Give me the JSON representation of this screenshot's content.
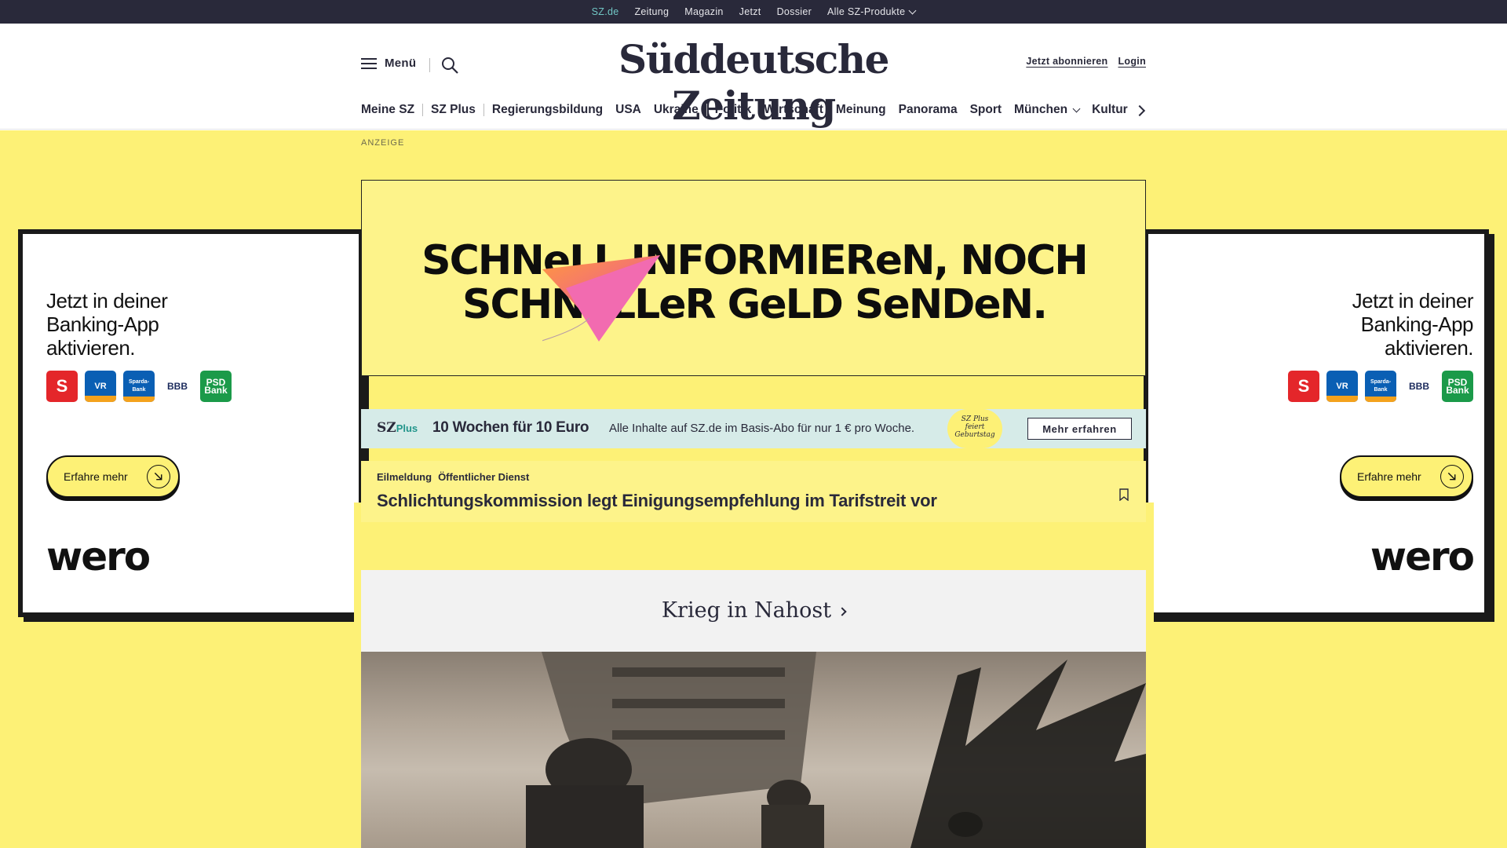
{
  "topbar": {
    "items": [
      {
        "label": "SZ.de"
      },
      {
        "label": "Zeitung"
      },
      {
        "label": "Magazin"
      },
      {
        "label": "Jetzt"
      },
      {
        "label": "Dossier"
      },
      {
        "label": "Alle SZ-Produkte"
      }
    ]
  },
  "header": {
    "menu_label": "Menü",
    "logo_text": "Süddeutsche Zeitung",
    "subscribe_label": "Jetzt abonnieren",
    "login_label": "Login"
  },
  "nav": {
    "items": [
      {
        "label": "Meine SZ"
      },
      {
        "label": "SZ Plus"
      },
      {
        "label": "Regierungsbildung"
      },
      {
        "label": "USA"
      },
      {
        "label": "Ukraine"
      },
      {
        "label": "Politik"
      },
      {
        "label": "Wirtschaft"
      },
      {
        "label": "Meinung"
      },
      {
        "label": "Panorama"
      },
      {
        "label": "Sport"
      },
      {
        "label": "München"
      },
      {
        "label": "Kultur"
      }
    ]
  },
  "ad": {
    "label": "ANZEIGE",
    "banner_line1": "SCHNeLL INFORMIEReN, NOCH",
    "banner_line2": "SCHNeLLeR GeLD SeNDeN.",
    "side_copy_line1": "Jetzt in deiner",
    "side_copy_line2": "Banking-App",
    "side_copy_line3": "aktivieren.",
    "cta_label": "Erfahre mehr",
    "brand": "wero",
    "banks": [
      "S",
      "VR",
      "Sparda-Bank",
      "BBB",
      "PSD Bank"
    ]
  },
  "plus": {
    "logo": "SZ",
    "logo_suffix": "Plus",
    "title": "10 Wochen für 10 Euro",
    "text": "Alle Inhalte auf SZ.de im Basis-Abo für nur 1 € pro Woche.",
    "badge_line1": "SZ Plus",
    "badge_line2": "feiert",
    "badge_line3": "Geburtstag",
    "button_label": "Mehr erfahren"
  },
  "breaking": {
    "kicker": "Eilmeldung",
    "topic": "Öffentlicher Dienst",
    "headline": "Schlichtungskommission legt Einigungsempfehlung im Tarifstreit vor"
  },
  "topic": {
    "title": "Krieg in Nahost"
  },
  "colors": {
    "dark": "#29293a",
    "accent": "#71c6c4",
    "ad_yellow": "#fdf176",
    "plus_bg": "#d6ebe8"
  }
}
